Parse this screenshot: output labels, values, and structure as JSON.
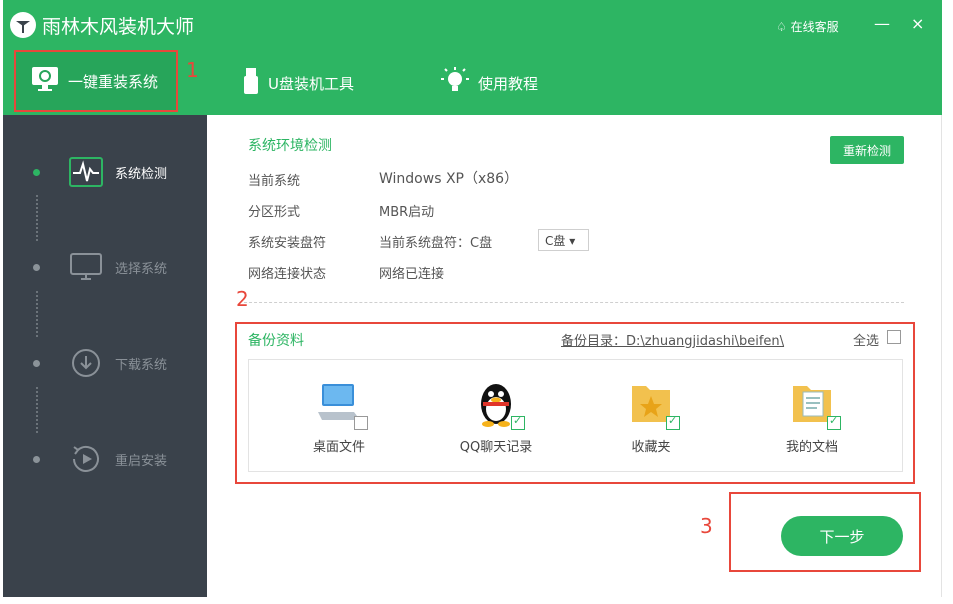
{
  "app": {
    "title": "雨林木风装机大师",
    "support": "在线客服",
    "minimize": "—",
    "close": "×"
  },
  "nav": {
    "tabs": [
      {
        "label": "一键重装系统",
        "icon": "monitor-refresh-icon"
      },
      {
        "label": "U盘装机工具",
        "icon": "usb-icon"
      },
      {
        "label": "使用教程",
        "icon": "lightbulb-icon"
      }
    ]
  },
  "annotations": {
    "n1": "1",
    "n2": "2",
    "n3": "3"
  },
  "sidebar": {
    "steps": [
      {
        "label": "系统检测",
        "icon": "heartbeat-icon"
      },
      {
        "label": "选择系统",
        "icon": "monitor-icon"
      },
      {
        "label": "下载系统",
        "icon": "download-icon"
      },
      {
        "label": "重启安装",
        "icon": "restart-icon"
      }
    ]
  },
  "env": {
    "title": "系统环境检测",
    "recheck": "重新检测",
    "rows": [
      {
        "label": "当前系统",
        "value": "Windows XP（x86）"
      },
      {
        "label": "分区形式",
        "value": "MBR启动"
      },
      {
        "label": "系统安装盘符",
        "value": "当前系统盘符：C盘"
      },
      {
        "label": "网络连接状态",
        "value": "网络已连接"
      }
    ],
    "drive_select": "C盘 ▾"
  },
  "backup": {
    "title": "备份资料",
    "dir_label": "备份目录：D:\\zhuangjidashi\\beifen\\",
    "select_all": "全选",
    "items": [
      {
        "label": "桌面文件",
        "checked": false
      },
      {
        "label": "QQ聊天记录",
        "checked": true
      },
      {
        "label": "收藏夹",
        "checked": true
      },
      {
        "label": "我的文档",
        "checked": true
      }
    ]
  },
  "next": "下一步",
  "colors": {
    "accent": "#2db563",
    "sidebar": "#3a424b",
    "annotation": "#e8473b"
  }
}
